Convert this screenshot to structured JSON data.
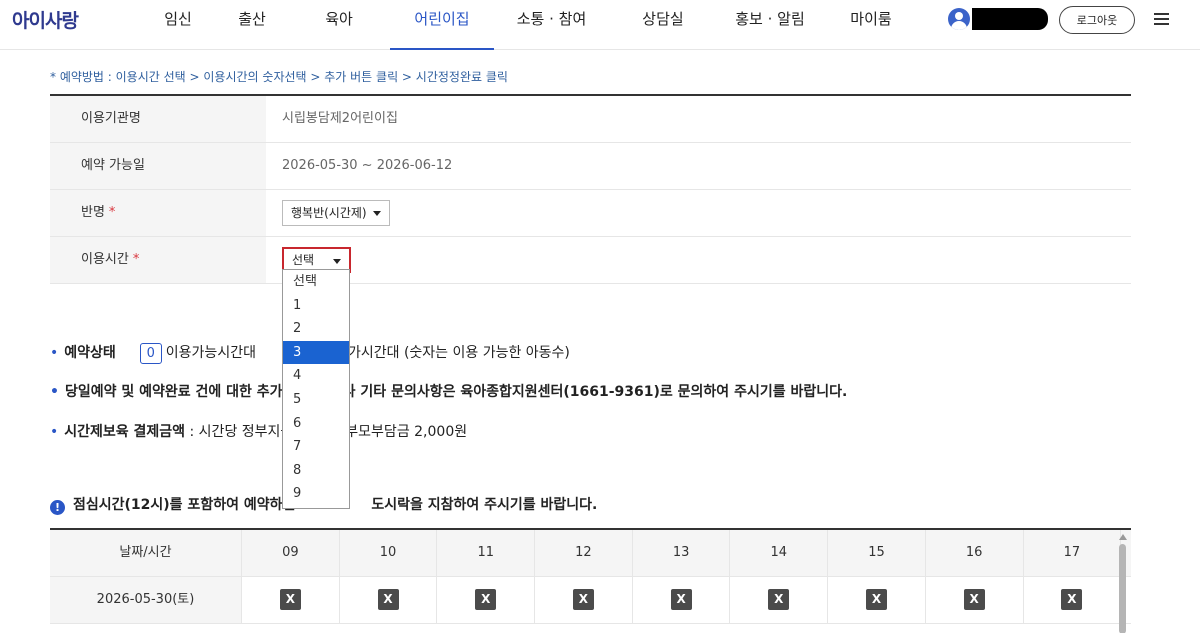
{
  "header": {
    "logo": "아이사랑",
    "nav": [
      {
        "label": "임신",
        "left": 0,
        "width": 76
      },
      {
        "label": "출산",
        "left": 0,
        "width": 72
      },
      {
        "label": "육아",
        "left": 0,
        "width": 102
      },
      {
        "label": "어린이집",
        "left": 0,
        "width": 104,
        "active": true
      },
      {
        "label": "소통 · 참여",
        "left": 0,
        "width": 115
      },
      {
        "label": "상담실",
        "left": 0,
        "width": 108
      },
      {
        "label": "홍보 · 알림",
        "left": 0,
        "width": 106
      },
      {
        "label": "마이룸",
        "left": 0,
        "width": 96
      }
    ],
    "logout_label": "로그아웃"
  },
  "instruction": "* 예약방법 : 이용시간 선택 > 이용시간의 숫자선택 > 추가 버튼 클릭 > 시간정정완료 클릭",
  "form": {
    "facility_label": "이용기관명",
    "facility_value": "시립봉담제2어린이집",
    "date_label": "예약 가능일",
    "date_value": "2026-05-30 ~ 2026-06-12",
    "class_label": "반명",
    "class_value": "행복반(시간제)",
    "time_label": "이용시간",
    "time_value": "선택"
  },
  "dropdown": {
    "options": [
      "선택",
      "1",
      "2",
      "3",
      "4",
      "5",
      "6",
      "7",
      "8",
      "9"
    ],
    "selected_index": 3
  },
  "info": {
    "status_label": "예약상태",
    "legend_number": "0",
    "legend_text": "이용가능시간대",
    "legend_tail": "가시간대 (숫자는 이용 가능한 아동수)",
    "inquiry_head": "당일예약 및 예약완료 건에 대한 추가 (",
    "inquiry_tail": "부나 기타 문의사항은 육아종합지원센터(1661-9361)로 문의하여 주시기를 바랍니다.",
    "fee_label": "시간제보육 결제금액",
    "fee_head": " : 시간당 정부지원",
    "fee_tail": "부모부담금 2,000원",
    "notice_icon": "!",
    "notice_head": "점심시간(12시)를 포함하여 예약하신",
    "notice_tail": "도시락을 지참하여 주시기를 바랍니다."
  },
  "schedule": {
    "header_first": "날짜/시간",
    "hours": [
      "09",
      "10",
      "11",
      "12",
      "13",
      "14",
      "15",
      "16",
      "17"
    ],
    "rows": [
      {
        "date": "2026-05-30(토)",
        "cells": [
          "X",
          "X",
          "X",
          "X",
          "X",
          "X",
          "X",
          "X",
          "X"
        ]
      }
    ]
  }
}
